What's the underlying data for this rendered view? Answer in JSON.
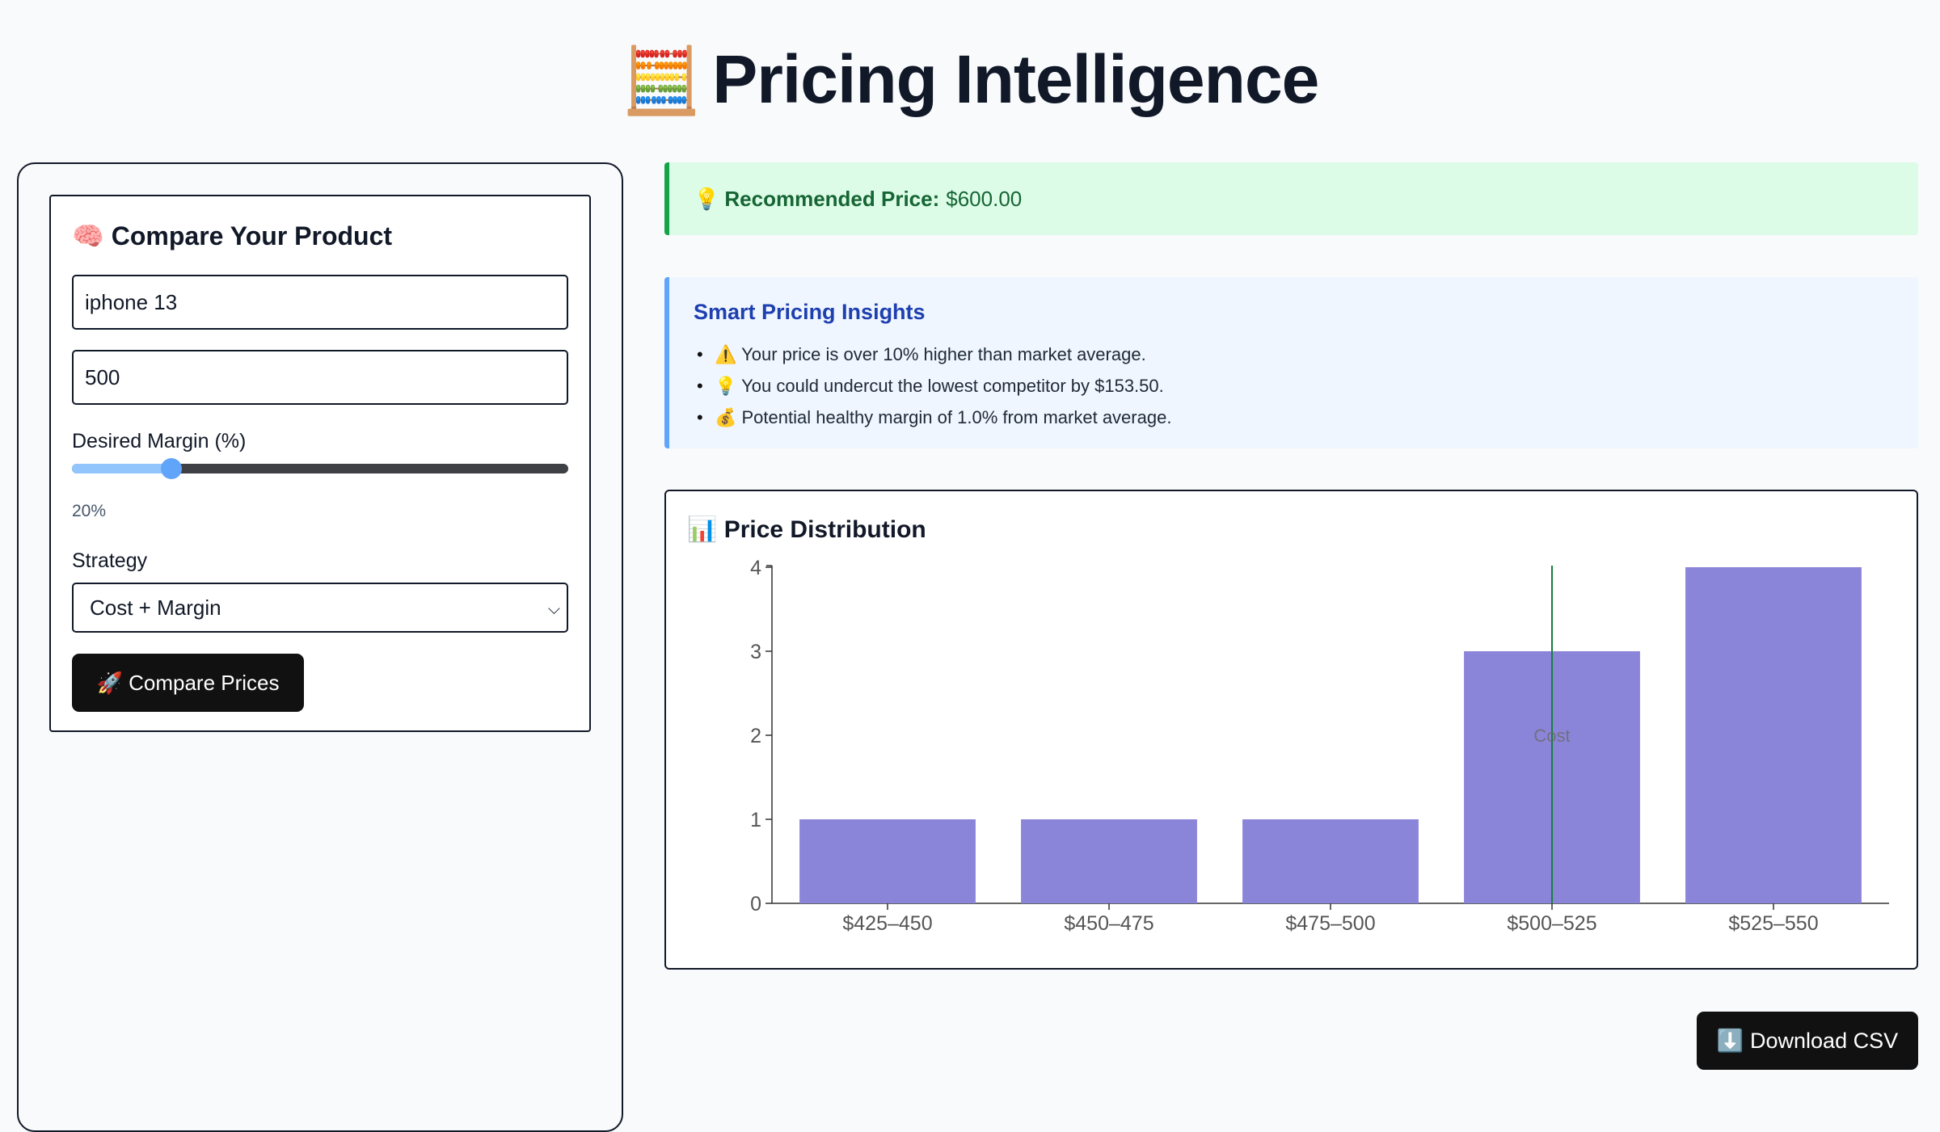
{
  "header": {
    "icon": "abacus-icon",
    "emoji": "🧮",
    "title": "Pricing Intelligence"
  },
  "form": {
    "icon": "brain-icon",
    "title": "🧠 Compare Your Product",
    "product_value": "iphone 13",
    "cost_value": "500",
    "margin_label": "Desired Margin (%)",
    "margin_fraction": 0.2,
    "margin_display": "20%",
    "strategy_label": "Strategy",
    "strategy_selected": "Cost + Margin",
    "compare_label": "🚀 Compare Prices"
  },
  "recommendation": {
    "icon": "lightbulb-icon",
    "emoji": "💡",
    "label": "Recommended Price:",
    "value": "$600.00"
  },
  "insights": {
    "title": "Smart Pricing Insights",
    "items": [
      "⚠️ Your price is over 10% higher than market average.",
      "💡 You could undercut the lowest competitor by $153.50.",
      "💰 Potential healthy margin of 1.0% from market average."
    ]
  },
  "chart": {
    "title": "📊 Price Distribution"
  },
  "chart_data": {
    "type": "bar",
    "title": "📊 Price Distribution",
    "categories": [
      "$425–450",
      "$450–475",
      "$475–500",
      "$500–525",
      "$525–550"
    ],
    "values": [
      1,
      1,
      1,
      3,
      4
    ],
    "ylim": [
      0,
      4
    ],
    "yticks": [
      0,
      1,
      2,
      3,
      4
    ],
    "bar_color": "#8b85d9",
    "reference_line": {
      "category": "$500–525",
      "label": "Cost",
      "color": "#15803d"
    }
  },
  "download": {
    "icon": "download-icon",
    "label": "⬇️ Download CSV"
  }
}
